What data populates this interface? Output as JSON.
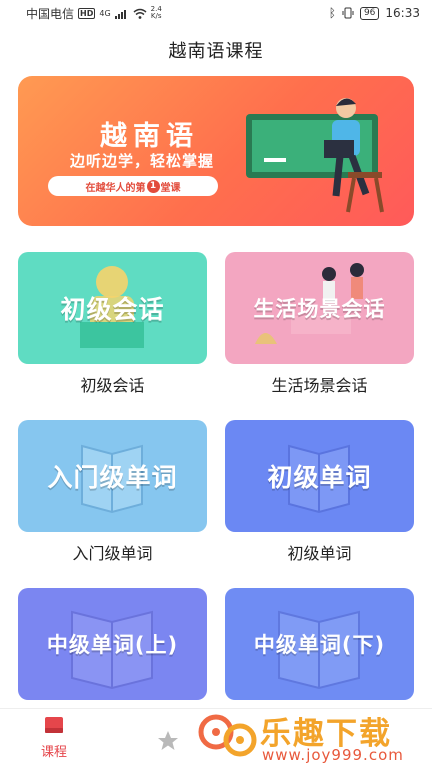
{
  "status_bar": {
    "carrier": "中国电信",
    "hd": "HD",
    "signal": "4G",
    "speed_value": "2.4",
    "speed_unit": "K/s",
    "battery": "96",
    "time": "16:33"
  },
  "header": {
    "title": "越南语课程"
  },
  "banner": {
    "title": "越南语",
    "subtitle": "边听边学，轻松掌握",
    "pill_prefix": "在越华人的第",
    "pill_number": "1",
    "pill_suffix": "堂课"
  },
  "cards": [
    {
      "image_text": "初级会话",
      "label": "初级会话",
      "color": "#5fdcc2"
    },
    {
      "image_text": "生活场景会话",
      "label": "生活场景会话",
      "color": "#f3a6c1"
    },
    {
      "image_text": "入门级单词",
      "label": "入门级单词",
      "color": "#86c6ef"
    },
    {
      "image_text": "初级单词",
      "label": "初级单词",
      "color": "#6b88f3"
    },
    {
      "image_text": "中级单词(上)",
      "label": "",
      "color": "#7b86f1"
    },
    {
      "image_text": "中级单词(下)",
      "label": "",
      "color": "#6f8cf3"
    }
  ],
  "bottom_nav": {
    "items": [
      {
        "label": "课程",
        "icon": "book-icon",
        "active": true
      },
      {
        "label": "",
        "icon": "star-icon",
        "active": false
      }
    ],
    "active_color": "#e5464b"
  },
  "watermark": {
    "text": "乐趣下载",
    "url": "www.joy999.com"
  }
}
